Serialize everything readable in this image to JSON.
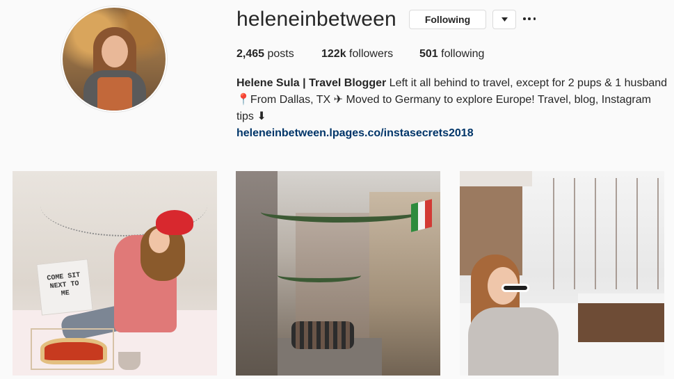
{
  "profile": {
    "username": "heleneinbetween",
    "follow_button_label": "Following",
    "posts_count": "2,465",
    "posts_label": "posts",
    "followers_count": "122k",
    "followers_label": "followers",
    "following_count": "501",
    "following_label": "following",
    "bio_name": "Helene Sula | Travel Blogger",
    "bio_text": " Left it all behind to travel, except for 2 pups & 1 husband 📍From Dallas, TX ✈ Moved to Germany to explore Europe! Travel, blog, Instagram tips ⬇",
    "bio_link": "heleneinbetween.lpages.co/instasecrets2018"
  },
  "posts": {
    "post1": {
      "pillow_text": "COME SIT NEXT TO ME"
    }
  },
  "icons": {
    "dropdown": "chevron-down-icon",
    "more": "more-options-icon"
  }
}
